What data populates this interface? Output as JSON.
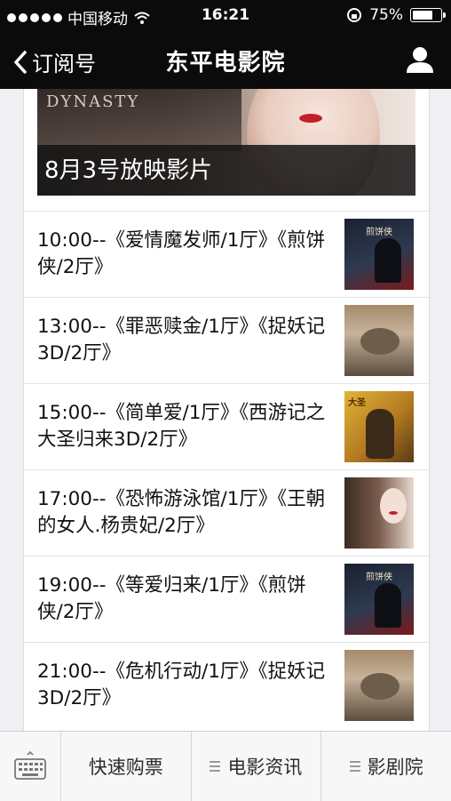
{
  "status_bar": {
    "carrier": "中国移动",
    "time": "16:21",
    "battery": "75%",
    "battery_level": 0.75
  },
  "nav": {
    "back_label": "订阅号",
    "title": "东平电影院"
  },
  "banner": {
    "logo_text": "DYNASTY",
    "caption": "8月3号放映影片"
  },
  "schedule": [
    {
      "text": "10:00--《爱情魔发师/1厅》《煎饼侠/2厅》",
      "thumb": "jianbing",
      "thumb_text": "煎饼侠"
    },
    {
      "text": "13:00--《罪恶赎金/1厅》《捉妖记3D/2厅》",
      "thumb": "zhuoyao",
      "thumb_text": ""
    },
    {
      "text": "15:00--《简单爱/1厅》《西游记之大圣归来3D/2厅》",
      "thumb": "xiyou",
      "thumb_text": "大圣"
    },
    {
      "text": "17:00--《恐怖游泳馆/1厅》《王朝的女人.杨贵妃/2厅》",
      "thumb": "wangchao",
      "thumb_text": ""
    },
    {
      "text": "19:00--《等爱归来/1厅》《煎饼侠/2厅》",
      "thumb": "jianbing",
      "thumb_text": "煎饼侠"
    },
    {
      "text": "21:00--《危机行动/1厅》《捉妖记3D/2厅》",
      "thumb": "zhuoyao",
      "thumb_text": ""
    }
  ],
  "tabbar": {
    "tab1": "快速购票",
    "tab2": "电影资讯",
    "tab3": "影剧院"
  }
}
